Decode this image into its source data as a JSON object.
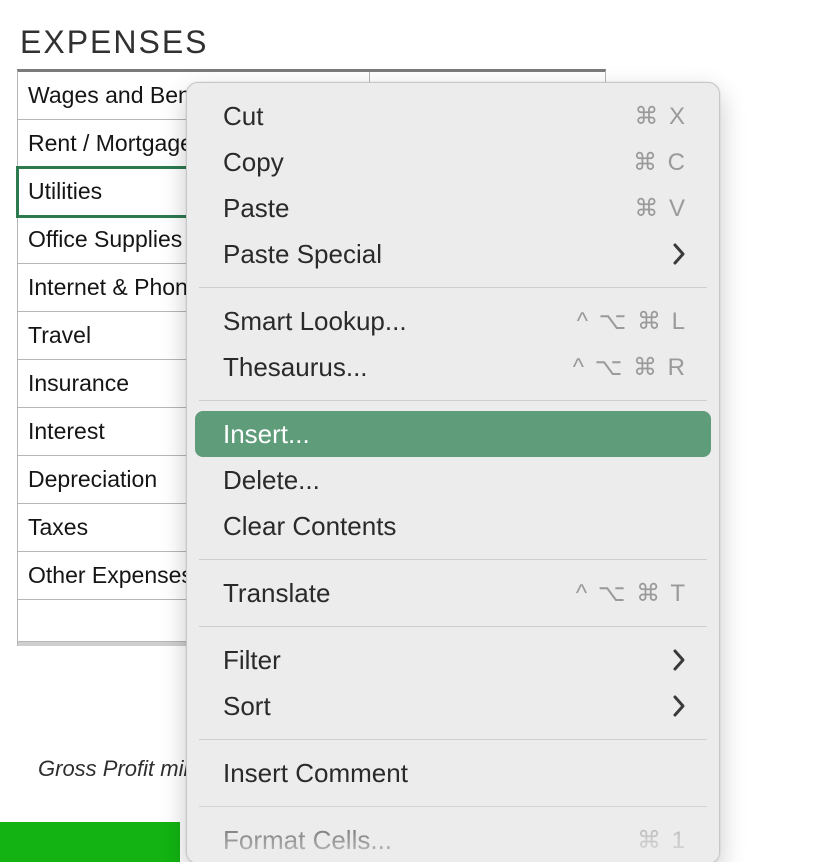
{
  "section_title": "EXPENSES",
  "rows": [
    "Wages and Benefits",
    "Rent / Mortgage",
    "Utilities",
    "Office Supplies",
    "Internet & Phone",
    "Travel",
    "Insurance",
    "Interest",
    "Depreciation",
    "Taxes",
    "Other Expenses"
  ],
  "selected_row_index": 2,
  "footnote": "Gross Profit minus Total Expenses",
  "menu": {
    "cut": {
      "label": "Cut",
      "shortcut": "⌘ X"
    },
    "copy": {
      "label": "Copy",
      "shortcut": "⌘ C"
    },
    "paste": {
      "label": "Paste",
      "shortcut": "⌘ V"
    },
    "paste_special": {
      "label": "Paste Special"
    },
    "smart_lookup": {
      "label": "Smart Lookup...",
      "shortcut": "^ ⌥ ⌘ L"
    },
    "thesaurus": {
      "label": "Thesaurus...",
      "shortcut": "^ ⌥ ⌘ R"
    },
    "insert": {
      "label": "Insert..."
    },
    "delete": {
      "label": "Delete..."
    },
    "clear": {
      "label": "Clear Contents"
    },
    "translate": {
      "label": "Translate",
      "shortcut": "^ ⌥ ⌘ T"
    },
    "filter": {
      "label": "Filter"
    },
    "sort": {
      "label": "Sort"
    },
    "comment": {
      "label": "Insert Comment"
    },
    "format_cells": {
      "label": "Format Cells...",
      "shortcut": "⌘ 1"
    }
  }
}
